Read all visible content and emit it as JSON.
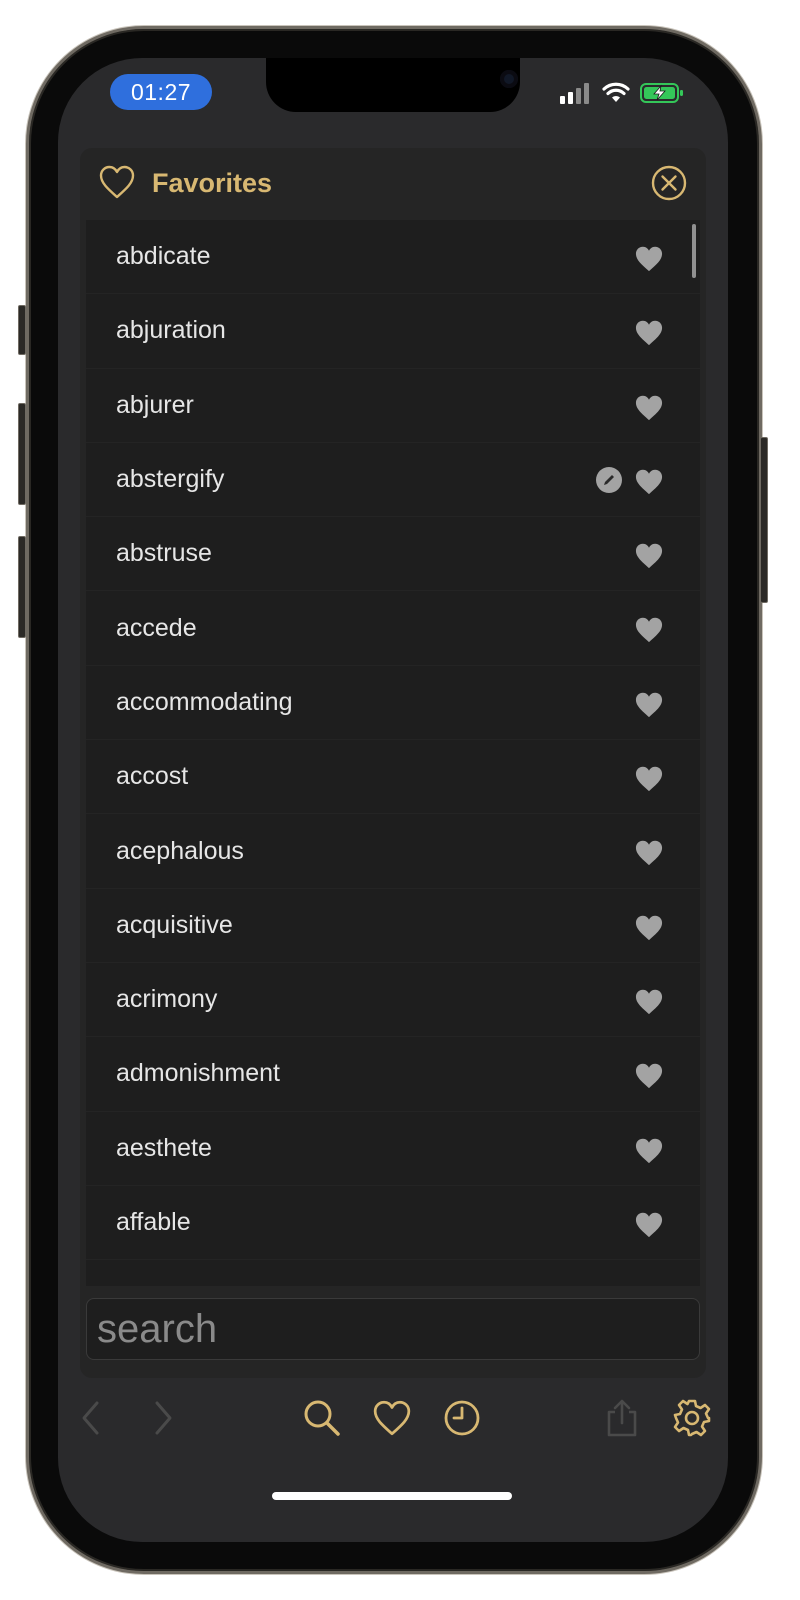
{
  "status_bar": {
    "time": "01:27"
  },
  "favorites": {
    "title": "Favorites",
    "items": [
      {
        "word": "abdicate",
        "has_note": false
      },
      {
        "word": "abjuration",
        "has_note": false
      },
      {
        "word": "abjurer",
        "has_note": false
      },
      {
        "word": "abstergify",
        "has_note": true
      },
      {
        "word": "abstruse",
        "has_note": false
      },
      {
        "word": "accede",
        "has_note": false
      },
      {
        "word": "accommodating",
        "has_note": false
      },
      {
        "word": "accost",
        "has_note": false
      },
      {
        "word": "acephalous",
        "has_note": false
      },
      {
        "word": "acquisitive",
        "has_note": false
      },
      {
        "word": "acrimony",
        "has_note": false
      },
      {
        "word": "admonishment",
        "has_note": false
      },
      {
        "word": "aesthete",
        "has_note": false
      },
      {
        "word": "affable",
        "has_note": false
      }
    ]
  },
  "search": {
    "placeholder": "search"
  },
  "toolbar": {
    "buttons": [
      "back-icon",
      "forward-icon",
      "search-icon",
      "heart-icon",
      "clock-icon",
      "share-icon",
      "gear-icon"
    ]
  },
  "colors": {
    "accent": "#d8b872",
    "time_pill": "#2f6fdd",
    "heart_fill": "#a3a3a3",
    "battery": "#34c759"
  }
}
